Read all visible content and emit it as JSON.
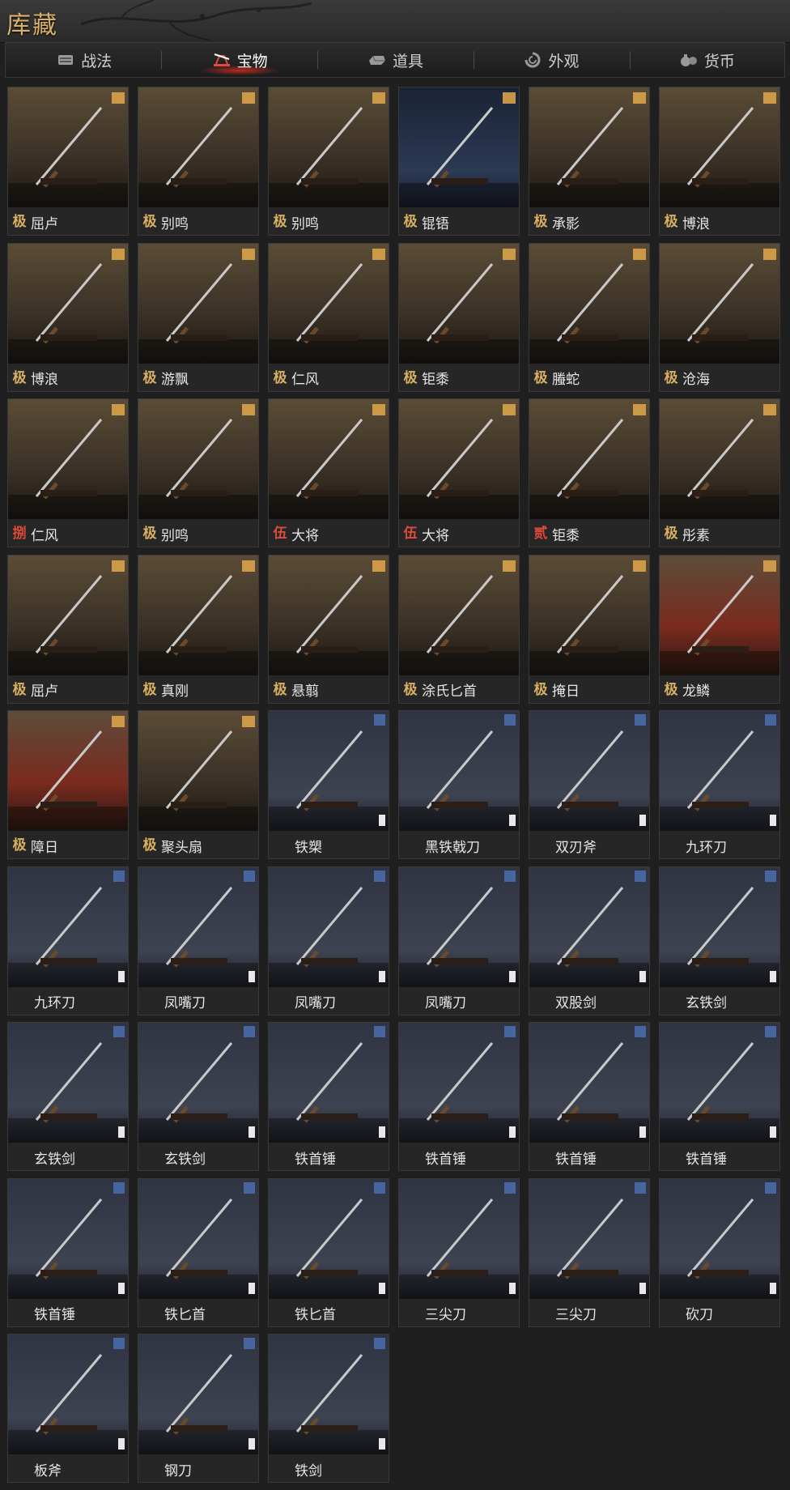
{
  "header": {
    "title": "库藏"
  },
  "tabs": [
    {
      "label": "战法",
      "icon": "scroll-icon",
      "active": false
    },
    {
      "label": "宝物",
      "icon": "treasure-stand-icon",
      "active": true
    },
    {
      "label": "道具",
      "icon": "ingot-icon",
      "active": false
    },
    {
      "label": "外观",
      "icon": "swirl-icon",
      "active": false
    },
    {
      "label": "货币",
      "icon": "money-bag-icon",
      "active": false
    }
  ],
  "colors": {
    "rank_gold": "#d9b061",
    "rank_red": "#e04a3a",
    "active_glow": "#dc281e"
  },
  "items": [
    {
      "rank": "极",
      "name": "屈卢",
      "theme": "warm"
    },
    {
      "rank": "极",
      "name": "别鸣",
      "theme": "warm"
    },
    {
      "rank": "极",
      "name": "别鸣",
      "theme": "warm"
    },
    {
      "rank": "极",
      "name": "锟铻",
      "theme": "night"
    },
    {
      "rank": "极",
      "name": "承影",
      "theme": "warm"
    },
    {
      "rank": "极",
      "name": "博浪",
      "theme": "warm"
    },
    {
      "rank": "极",
      "name": "博浪",
      "theme": "warm"
    },
    {
      "rank": "极",
      "name": "游飘",
      "theme": "warm"
    },
    {
      "rank": "极",
      "name": "仁风",
      "theme": "warm"
    },
    {
      "rank": "极",
      "name": "钜黍",
      "theme": "warm"
    },
    {
      "rank": "极",
      "name": "螣蛇",
      "theme": "warm"
    },
    {
      "rank": "极",
      "name": "沧海",
      "theme": "warm"
    },
    {
      "rank": "捌",
      "name": "仁风",
      "theme": "warm"
    },
    {
      "rank": "极",
      "name": "别鸣",
      "theme": "warm"
    },
    {
      "rank": "伍",
      "name": "大将",
      "theme": "warm"
    },
    {
      "rank": "伍",
      "name": "大将",
      "theme": "warm"
    },
    {
      "rank": "贰",
      "name": "钜黍",
      "theme": "warm"
    },
    {
      "rank": "极",
      "name": "彤素",
      "theme": "warm"
    },
    {
      "rank": "极",
      "name": "屈卢",
      "theme": "warm"
    },
    {
      "rank": "极",
      "name": "真刚",
      "theme": "warm"
    },
    {
      "rank": "极",
      "name": "悬翦",
      "theme": "warm"
    },
    {
      "rank": "极",
      "name": "涂氏匕首",
      "theme": "warm"
    },
    {
      "rank": "极",
      "name": "掩日",
      "theme": "warm"
    },
    {
      "rank": "极",
      "name": "龙鳞",
      "theme": "red"
    },
    {
      "rank": "极",
      "name": "障日",
      "theme": "red"
    },
    {
      "rank": "极",
      "name": "聚头扇",
      "theme": "warm"
    },
    {
      "rank": "",
      "name": "铁槊",
      "theme": "blue"
    },
    {
      "rank": "",
      "name": "黑铁戟刀",
      "theme": "blue"
    },
    {
      "rank": "",
      "name": "双刃斧",
      "theme": "blue"
    },
    {
      "rank": "",
      "name": "九环刀",
      "theme": "blue"
    },
    {
      "rank": "",
      "name": "九环刀",
      "theme": "blue"
    },
    {
      "rank": "",
      "name": "凤嘴刀",
      "theme": "blue"
    },
    {
      "rank": "",
      "name": "凤嘴刀",
      "theme": "blue"
    },
    {
      "rank": "",
      "name": "凤嘴刀",
      "theme": "blue"
    },
    {
      "rank": "",
      "name": "双股剑",
      "theme": "blue"
    },
    {
      "rank": "",
      "name": "玄铁剑",
      "theme": "blue"
    },
    {
      "rank": "",
      "name": "玄铁剑",
      "theme": "blue"
    },
    {
      "rank": "",
      "name": "玄铁剑",
      "theme": "blue"
    },
    {
      "rank": "",
      "name": "铁首锤",
      "theme": "blue"
    },
    {
      "rank": "",
      "name": "铁首锤",
      "theme": "blue"
    },
    {
      "rank": "",
      "name": "铁首锤",
      "theme": "blue"
    },
    {
      "rank": "",
      "name": "铁首锤",
      "theme": "blue"
    },
    {
      "rank": "",
      "name": "铁首锤",
      "theme": "blue"
    },
    {
      "rank": "",
      "name": "铁匕首",
      "theme": "blue"
    },
    {
      "rank": "",
      "name": "铁匕首",
      "theme": "blue"
    },
    {
      "rank": "",
      "name": "三尖刀",
      "theme": "blue"
    },
    {
      "rank": "",
      "name": "三尖刀",
      "theme": "blue"
    },
    {
      "rank": "",
      "name": "砍刀",
      "theme": "blue"
    },
    {
      "rank": "",
      "name": "板斧",
      "theme": "blue"
    },
    {
      "rank": "",
      "name": "钢刀",
      "theme": "blue"
    },
    {
      "rank": "",
      "name": "铁剑",
      "theme": "blue"
    }
  ]
}
